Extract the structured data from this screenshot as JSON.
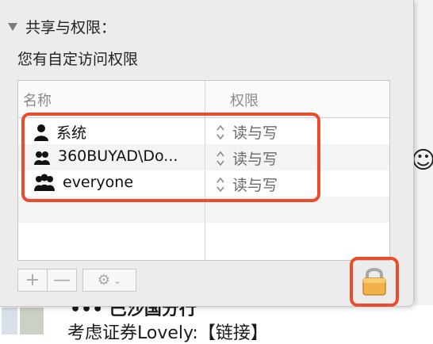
{
  "panel": {
    "section_title": "共享与权限：",
    "custom_access": "您有自定访问权限"
  },
  "table": {
    "columns": [
      "名称",
      "权限"
    ],
    "rows": [
      {
        "name": "系统",
        "icon": "user-icon",
        "permission": "读与写"
      },
      {
        "name": "360BUYAD\\Do...",
        "icon": "group-icon",
        "permission": "读与写"
      },
      {
        "name": "everyone",
        "icon": "everyone-icon",
        "permission": "读与写"
      }
    ]
  },
  "toolbar": {
    "add_label": "+",
    "remove_label": "—",
    "gear_label": "⚙"
  },
  "background": {
    "line1": "••• 巴沙国分行",
    "line2": "考虑证券Lovely:【链接】"
  },
  "colors": {
    "highlight": "#ea4d2b",
    "panel_bg": "#ececec"
  }
}
